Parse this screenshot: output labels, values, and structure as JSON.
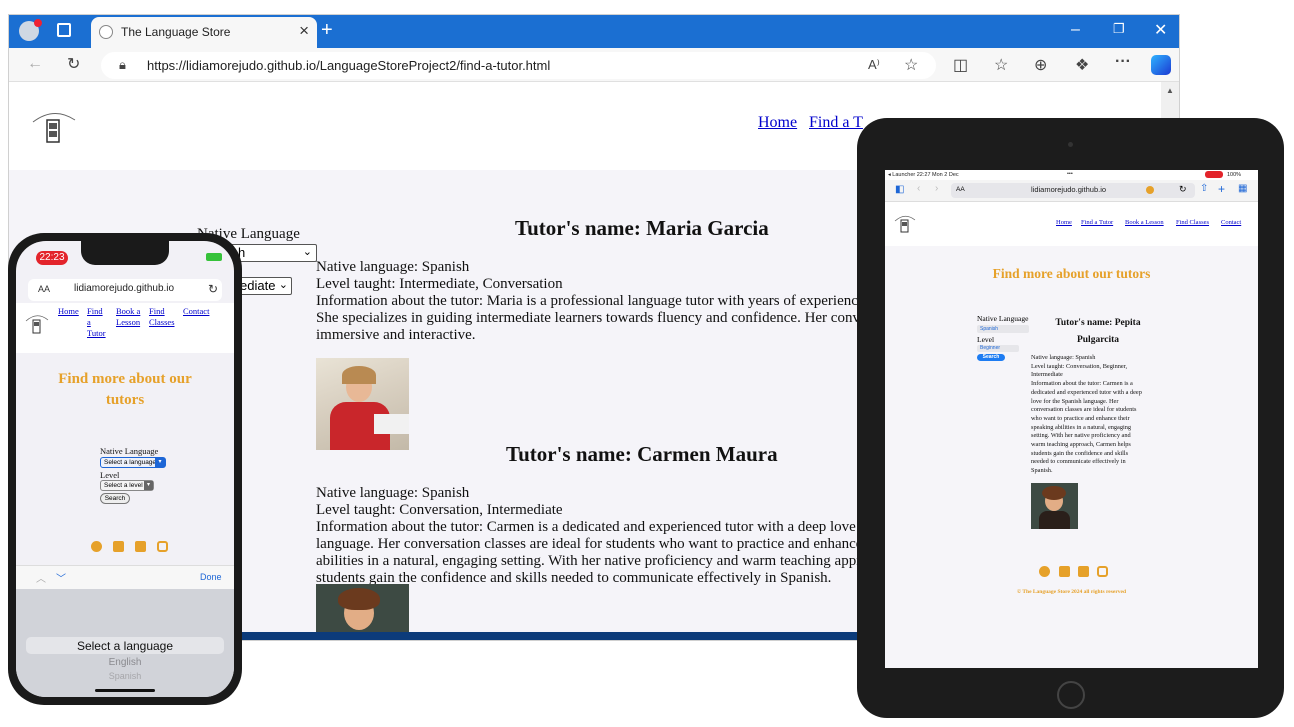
{
  "desktop": {
    "tab_title": "The Language Store",
    "url": "https://lidiamorejudo.github.io/LanguageStoreProject2/find-a-tutor.html",
    "nav": [
      "Home",
      "Find a T"
    ],
    "form": {
      "native_label": "Native Language",
      "native_value": "h",
      "level_value": "ediate"
    },
    "tutors": [
      {
        "name": "Tutor's name: Maria Garcia",
        "native": "Native language: Spanish",
        "level": "Level taught: Intermediate, Conversation",
        "info_lines": [
          "Information about the tutor: Maria is a professional language tutor with years of experience",
          "She specializes in guiding intermediate learners towards fluency and confidence. Her conve",
          "immersive and interactive."
        ]
      },
      {
        "name": "Tutor's name: Carmen Maura",
        "native": "Native language: Spanish",
        "level": "Level taught: Conversation, Intermediate",
        "info_lines": [
          "Information about the tutor: Carmen is a dedicated and experienced tutor with a deep love f",
          "language. Her conversation classes are ideal for students who want to practice and enhance",
          "abilities in a natural, engaging setting. With her native proficiency and warm teaching appro",
          "students gain the confidence and skills needed to communicate effectively in Spanish."
        ]
      }
    ]
  },
  "phone": {
    "time": "22:23",
    "url": "lidiamorejudo.github.io",
    "aa": "AA",
    "nav": [
      {
        "line1": "Home",
        "line2": "",
        "line3": ""
      },
      {
        "line1": "Find",
        "line2": "a",
        "line3": "Tutor"
      },
      {
        "line1": "Book a",
        "line2": "Lesson",
        "line3": ""
      },
      {
        "line1": "Find",
        "line2": "Classes",
        "line3": ""
      },
      {
        "line1": "Contact",
        "line2": "",
        "line3": ""
      }
    ],
    "heading_line1": "Find more about our",
    "heading_line2": "tutors",
    "native_label": "Native Language",
    "native_select": "Select a language",
    "level_label": "Level",
    "level_select": "Select a level",
    "search": "Search",
    "done": "Done",
    "picker": [
      "Select a language",
      "English",
      "Spanish"
    ]
  },
  "tablet": {
    "status_left": "◂ Launcher  22:27  Mon 2 Dec",
    "status_dots": "•••",
    "battery": "100%",
    "aa": "AA",
    "url": "lidiamorejudo.github.io",
    "nav": [
      "Home",
      "Find a Tutor",
      "Book a Lesson",
      "Find Classes",
      "Contact"
    ],
    "heading": "Find more about our tutors",
    "native_label": "Native Language",
    "native_value": "Spanish",
    "level_label": "Level",
    "level_value": "Beginner",
    "search": "Search",
    "tutor_name_line1": "Tutor's name: Pepita",
    "tutor_name_line2": "Pulgarcita",
    "native": "Native language: Spanish",
    "level_lines": [
      "Level taught: Conversation, Beginner,",
      "Intermediate"
    ],
    "info_lines": [
      "Information about the tutor: Carmen is a",
      "dedicated and experienced tutor with a deep",
      "love for the Spanish language. Her",
      "conversation classes are ideal for students",
      "who want to practice and enhance their",
      "speaking abilities in a natural, engaging",
      "setting. With her native proficiency and",
      "warm teaching approach, Carmen helps",
      "students gain the confidence and skills",
      "needed to communicate effectively in",
      "Spanish."
    ],
    "footer": "© The Language Store 2024 all rights reserved"
  },
  "colors": {
    "edge_blue": "#1b6fd2",
    "gold": "#e6a12a",
    "link": "#0000cc"
  }
}
